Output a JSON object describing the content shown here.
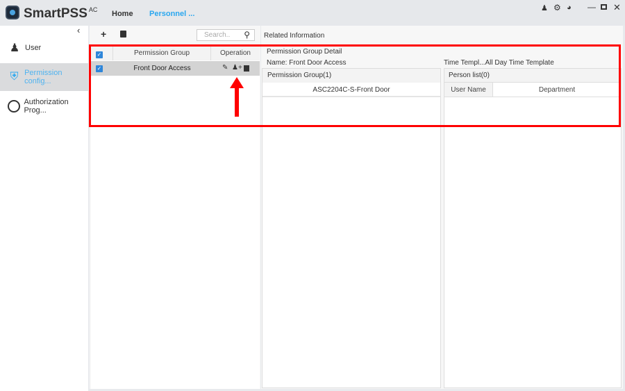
{
  "app": {
    "brand": "SmartPSS",
    "brand_sup": "AC"
  },
  "nav": {
    "tabs": [
      {
        "label": "Home"
      },
      {
        "label": "Personnel ..."
      }
    ]
  },
  "window_controls": [
    "user-icon",
    "gear-icon",
    "gauge-icon",
    "minimize-icon",
    "maximize-icon",
    "close-icon"
  ],
  "sidebar": {
    "items": [
      {
        "label": "User",
        "icon": "user-gear-icon"
      },
      {
        "label": "Permission config...",
        "icon": "shield-key-icon",
        "selected": true
      },
      {
        "label": "Authorization Prog...",
        "icon": "clock-icon"
      }
    ]
  },
  "group_panel": {
    "search_placeholder": "Search..",
    "columns": [
      "Permission Group",
      "Operation"
    ],
    "rows": [
      {
        "name": "Front Door Access",
        "checked": true
      }
    ]
  },
  "related": {
    "title": "Related Information",
    "detail_title": "Permission Group Detail",
    "name_line": "Name: Front Door Access",
    "time_template": "Time Templ...All Day Time Template",
    "perm_group_header": "Permission Group(1)",
    "perm_group_items": [
      "ASC2204C-S-Front Door"
    ],
    "person_list_header": "Person list(0)",
    "person_columns": [
      "User Name",
      "Department"
    ]
  },
  "colors": {
    "accent": "#4fb3f0",
    "highlight": "#ff0000",
    "checkbox": "#2f86d9"
  }
}
